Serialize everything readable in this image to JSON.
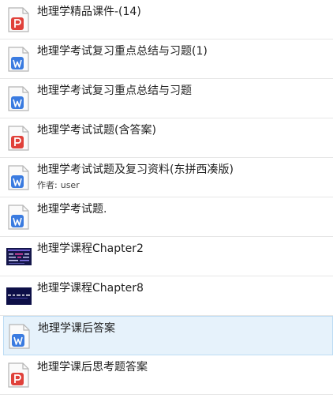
{
  "colors": {
    "pdf": "#e0413a",
    "word": "#3a7be0",
    "selected_bg": "#e6f2fb"
  },
  "files": [
    {
      "title": "地理学精品课件-(14)",
      "icon": "pdf-file-icon"
    },
    {
      "title": "地理学考试复习重点总结与习题(1)",
      "icon": "word-file-icon"
    },
    {
      "title": "地理学考试复习重点总结与习题",
      "icon": "word-file-icon"
    },
    {
      "title": "地理学考试试题(含答案)",
      "icon": "pdf-file-icon"
    },
    {
      "title": "地理学考试试题及复习资料(东拼西凑版)",
      "icon": "word-file-icon",
      "author_label": "作者:",
      "author": "user"
    },
    {
      "title": "地理学考试题.",
      "icon": "word-file-icon"
    },
    {
      "title": "地理学课程Chapter2",
      "icon": "slide-thumbnail"
    },
    {
      "title": "地理学课程Chapter8",
      "icon": "slide-thumbnail"
    },
    {
      "title": "地理学课后答案",
      "icon": "word-file-icon",
      "selected": true
    },
    {
      "title": "地理学课后思考题答案",
      "icon": "pdf-file-icon"
    }
  ]
}
